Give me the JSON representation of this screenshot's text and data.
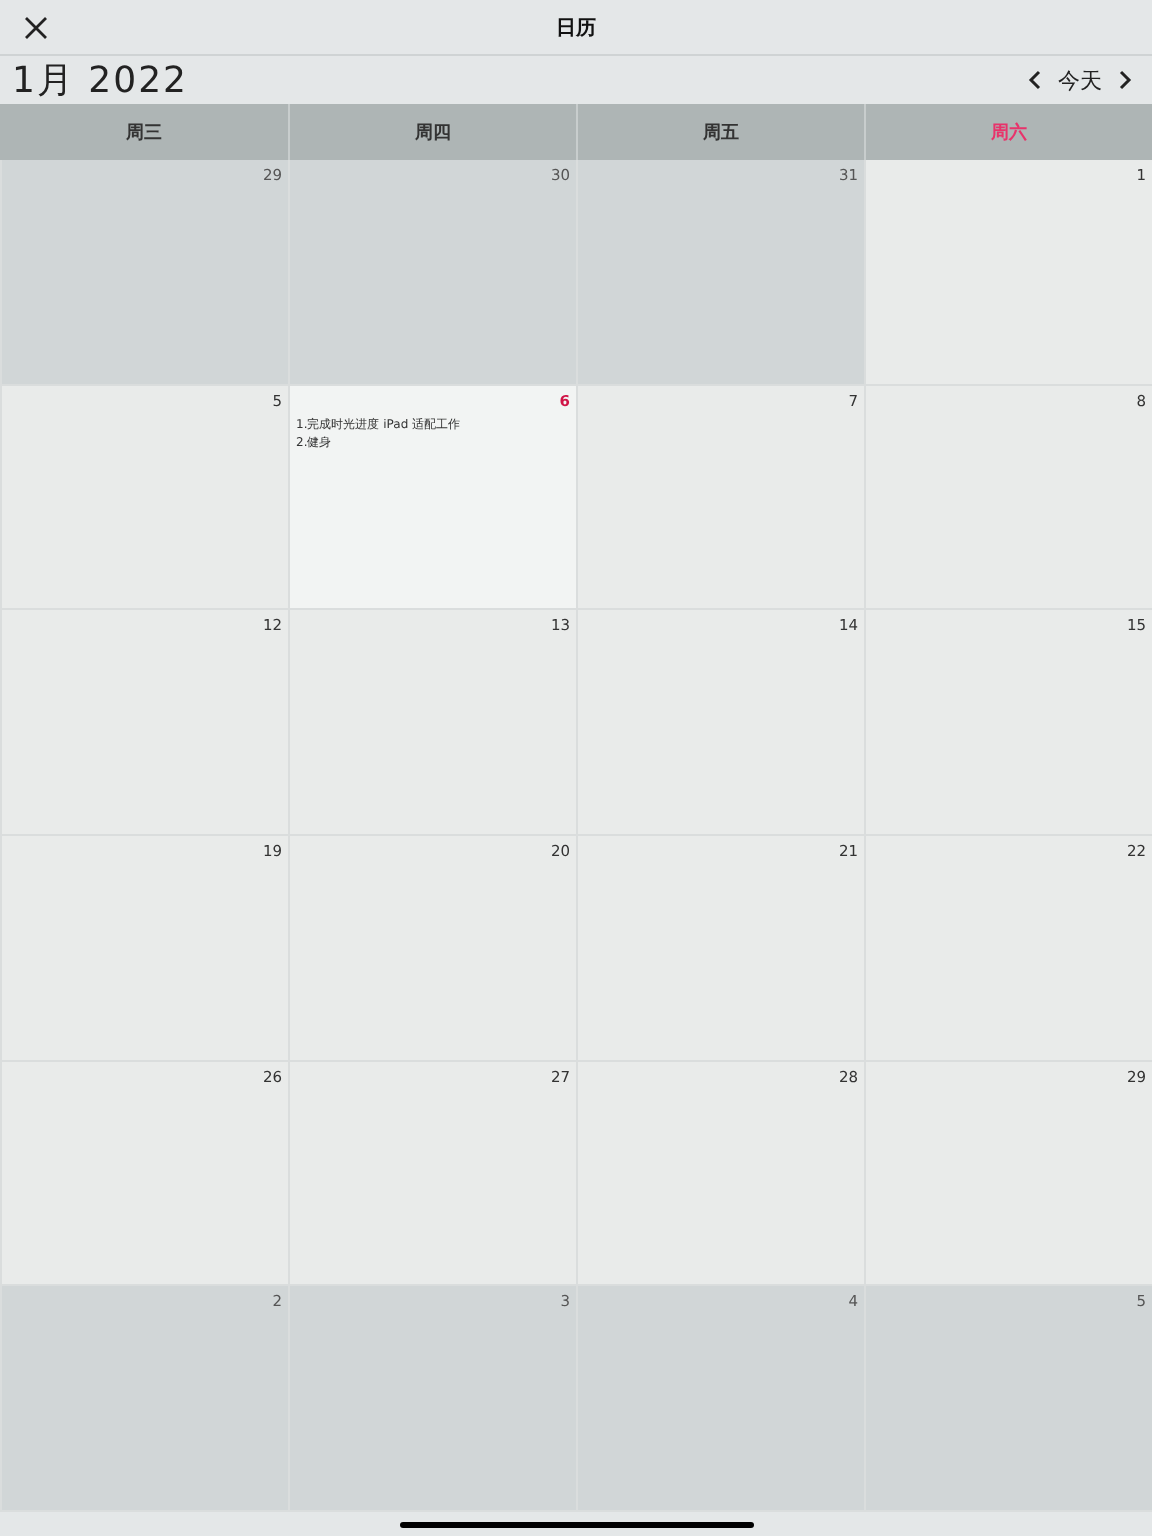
{
  "nav": {
    "title": "日历"
  },
  "month": {
    "label": "1月 2022",
    "today_button": "今天"
  },
  "weekdays": [
    {
      "label": "周三",
      "weekend": false
    },
    {
      "label": "周四",
      "weekend": false
    },
    {
      "label": "周五",
      "weekend": false
    },
    {
      "label": "周六",
      "weekend": true
    }
  ],
  "weeks": [
    [
      {
        "day": "29",
        "outside": true,
        "today": false
      },
      {
        "day": "30",
        "outside": true,
        "today": false
      },
      {
        "day": "31",
        "outside": true,
        "today": false
      },
      {
        "day": "1",
        "outside": false,
        "today": false
      }
    ],
    [
      {
        "day": "5",
        "outside": false,
        "today": false
      },
      {
        "day": "6",
        "outside": false,
        "today": true,
        "events": [
          "1.完成时光进度 iPad 适配工作",
          "2.健身"
        ]
      },
      {
        "day": "7",
        "outside": false,
        "today": false
      },
      {
        "day": "8",
        "outside": false,
        "today": false
      }
    ],
    [
      {
        "day": "12",
        "outside": false,
        "today": false
      },
      {
        "day": "13",
        "outside": false,
        "today": false
      },
      {
        "day": "14",
        "outside": false,
        "today": false
      },
      {
        "day": "15",
        "outside": false,
        "today": false
      }
    ],
    [
      {
        "day": "19",
        "outside": false,
        "today": false
      },
      {
        "day": "20",
        "outside": false,
        "today": false
      },
      {
        "day": "21",
        "outside": false,
        "today": false
      },
      {
        "day": "22",
        "outside": false,
        "today": false
      }
    ],
    [
      {
        "day": "26",
        "outside": false,
        "today": false
      },
      {
        "day": "27",
        "outside": false,
        "today": false
      },
      {
        "day": "28",
        "outside": false,
        "today": false
      },
      {
        "day": "29",
        "outside": false,
        "today": false
      }
    ],
    [
      {
        "day": "2",
        "outside": true,
        "today": false
      },
      {
        "day": "3",
        "outside": true,
        "today": false
      },
      {
        "day": "4",
        "outside": true,
        "today": false
      },
      {
        "day": "5",
        "outside": true,
        "today": false
      }
    ]
  ]
}
